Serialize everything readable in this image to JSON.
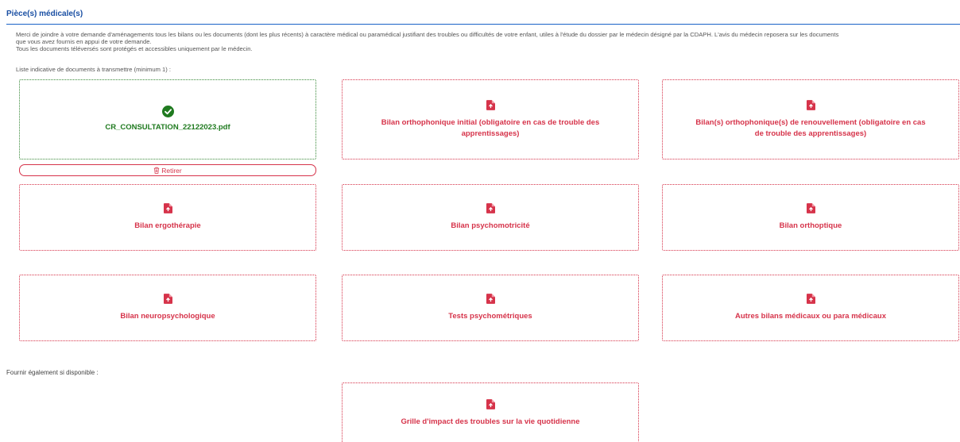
{
  "section": {
    "title": "Pièce(s) médicale(s)"
  },
  "intro": {
    "lines": [
      "Merci de joindre à votre demande d'aménagements tous les bilans ou les documents (dont les plus récents) à caractère médical ou paramédical justifiant des troubles ou difficultés de votre enfant, utiles à l'étude du dossier par le médecin désigné par la CDAPH. L'avis du médecin reposera sur les documents",
      "que vous avez fournis en appui de votre demande.",
      "Tous les documents téléversés sont protégés et accessibles uniquement par le médecin."
    ]
  },
  "list_title": "Liste indicative de documents à transmettre (minimum 1) :",
  "uploaded": {
    "filename": "CR_CONSULTATION_22122023.pdf",
    "remove_label": "Retirer"
  },
  "documents": [
    {
      "label": "Bilan orthophonique initial (obligatoire en cas de trouble des apprentissages)"
    },
    {
      "label": "Bilan(s) orthophonique(s) de renouvellement (obligatoire en cas de trouble des apprentissages)"
    },
    {
      "label": "Bilan ergothérapie"
    },
    {
      "label": "Bilan psychomotricité"
    },
    {
      "label": "Bilan orthoptique"
    },
    {
      "label": "Bilan neuropsychologique"
    },
    {
      "label": "Tests psychométriques"
    },
    {
      "label": "Autres bilans médicaux ou para médicaux"
    }
  ],
  "also_label": "Fournir également si disponible :",
  "optional": {
    "label": "Grille d'impact des troubles sur la vie quotidienne"
  },
  "colors": {
    "accent_red": "#d6334a",
    "success_green": "#1f7a1f",
    "header_blue": "#1a4fa3"
  }
}
